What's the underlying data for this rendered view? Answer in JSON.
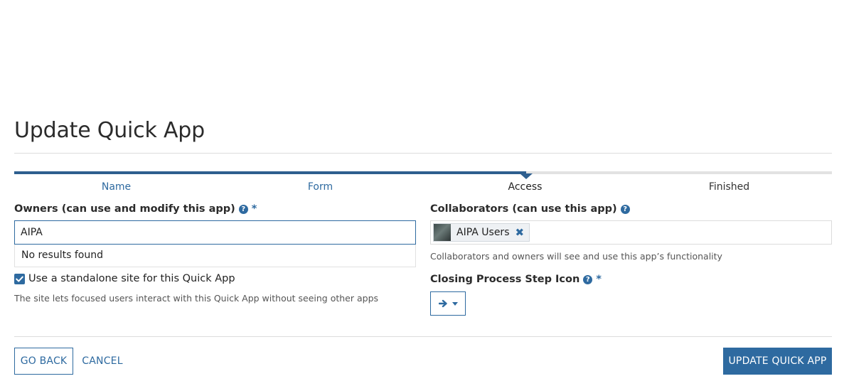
{
  "page": {
    "title": "Update Quick App"
  },
  "steps": [
    {
      "label": "Name",
      "state": "done"
    },
    {
      "label": "Form",
      "state": "done"
    },
    {
      "label": "Access",
      "state": "current"
    },
    {
      "label": "Finished",
      "state": "future"
    }
  ],
  "owners": {
    "label": "Owners (can use and modify this app)",
    "required_mark": "*",
    "input_value": "AIPA",
    "dropdown_message": "No results found"
  },
  "standalone": {
    "checked": true,
    "label": "Use a standalone site for this Quick App",
    "help": "The site lets focused users interact with this Quick App without seeing other apps"
  },
  "collaborators": {
    "label": "Collaborators (can use this app)",
    "chips": [
      {
        "label": "AIPA Users",
        "icon": "group-avatar"
      }
    ],
    "help": "Collaborators and owners will see and use this app’s functionality"
  },
  "closing_icon": {
    "label": "Closing Process Step Icon",
    "required_mark": "*",
    "selected_icon": "arrow-right-icon"
  },
  "footer": {
    "back_label": "GO BACK",
    "cancel_label": "CANCEL",
    "submit_label": "UPDATE QUICK APP"
  },
  "colors": {
    "accent": "#2e6aa0",
    "progress": "#2e5f8f"
  }
}
